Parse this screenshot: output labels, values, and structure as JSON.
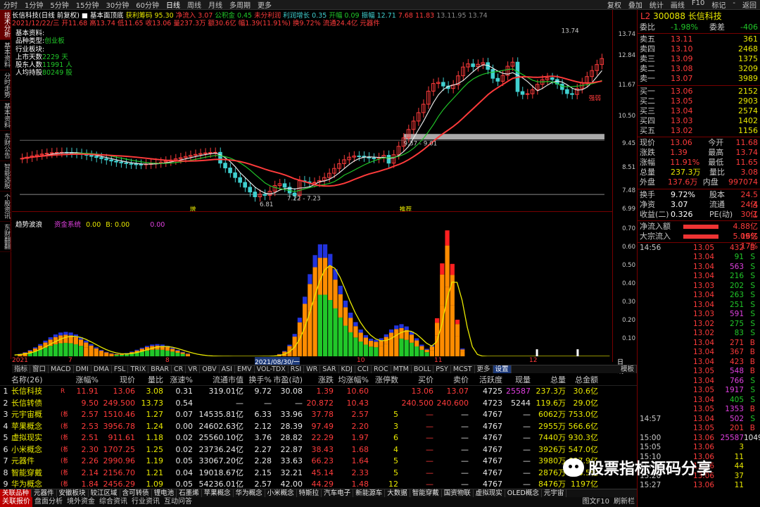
{
  "topbar": {
    "periods": [
      "分时",
      "1分钟",
      "5分钟",
      "15分钟",
      "30分钟",
      "60分钟",
      "日线",
      "周线",
      "月线",
      "多周期",
      "更多"
    ],
    "active": "日线",
    "right": [
      "复权",
      "叠加",
      "统计",
      "画线",
      "F10",
      "标记",
      "-",
      "返回"
    ]
  },
  "leftnav": [
    "技术分析",
    "基本资料",
    "分时走势",
    "基本资料",
    "东财公告",
    "智能选股",
    "个股资讯",
    "东财翻翻"
  ],
  "info": {
    "name": "长信科技(日线 前复权)",
    "indicator": "基本面顶底",
    "items": [
      [
        "获利筹码",
        "95.30",
        "yel"
      ],
      [
        "净流入",
        "3.07",
        "red"
      ],
      [
        "公积金",
        "0.45",
        "grn"
      ],
      [
        "未分利润",
        "",
        "red"
      ],
      [
        "利润增长",
        "0.35",
        "cy"
      ],
      [
        "开幅",
        "0.09",
        "grn"
      ],
      [
        "振幅",
        "12.71",
        "cy"
      ],
      [
        "7.68",
        "11.83",
        "red"
      ],
      [
        "13.11.95",
        "13.74",
        "gry"
      ]
    ],
    "ohlc": "2021/12/22/三  开11.68 高13.74 低11.65 收13.06 量237.3万 额30.6亿 幅1.39(11.91%) 换9.72% 流通24.4亿 元器件"
  },
  "basic": {
    "title": "基本资料:",
    "type_label": "品种类型:",
    "type": "创业板",
    "industry": "行业板块:",
    "days_label": "上市天数",
    "days": "2229",
    "days_unit": "天",
    "holders_label": "股东人数",
    "holders": "11991",
    "holders_unit": "人",
    "per_label": "人均持股",
    "per": "80249",
    "per_unit": "股"
  },
  "axis": {
    "main": [
      "13.74",
      "12.84",
      "11.67",
      "10.50",
      "9.45",
      "8.51",
      "7.48",
      "6.99"
    ],
    "ind": [
      "0.70",
      "0.60",
      "0.50",
      "0.40",
      "0.30",
      "0.20",
      "0.10"
    ]
  },
  "chart_labels": {
    "high": "13.74",
    "low1": "6.81",
    "low2": "7.22 - 7.23",
    "mid": "9.37 - 9.01",
    "label_jz": "强弱",
    "label_zeng": "增",
    "label_tuijian": "推荐",
    "label_s": "S"
  },
  "indicator": {
    "title": "趋势波浪",
    "sys": "资金系统",
    "v1": "0.00",
    "v2": "B: 0.00",
    "v3": "0.00"
  },
  "datebar": {
    "y": "2021",
    "m1": "7",
    "m2": "8",
    "sel": "2021/08/30/一",
    "m3": "10",
    "m4": "11",
    "m5": "12",
    "right": "日线"
  },
  "tabs": [
    "指标",
    "窗口",
    "MACD",
    "DMI",
    "DMA",
    "FSL",
    "TRIX",
    "BRAR",
    "CR",
    "VR",
    "OBV",
    "ASI",
    "EMV",
    "VOL-TDX",
    "RSI",
    "WR",
    "SAR",
    "KDJ",
    "CCI",
    "ROC",
    "MTM",
    "BOLL",
    "PSY",
    "MCST",
    "更多",
    "设置"
  ],
  "tabs_right": "模板",
  "table": {
    "headers": [
      "名称(26)",
      "涨幅%",
      "现价",
      "量比",
      "涨速%",
      "流通市值",
      "换手%",
      "市盈(动)",
      "涨跌",
      "均涨幅%",
      "涨停数",
      "买价",
      "卖价",
      "活跃度",
      "现量",
      "总量",
      "总金额"
    ],
    "rows": [
      [
        "1",
        "长信科技",
        "R",
        "11.91",
        "13.06",
        "3.08",
        "0.31",
        "319.01亿",
        "9.72",
        "30.08",
        "1.39",
        "10.60",
        "",
        "13.06",
        "13.07",
        "4725",
        "25587",
        "237.3万",
        "30.6亿"
      ],
      [
        "2",
        "长信转债",
        "",
        "9.50",
        "249.500",
        "13.73",
        "0.54",
        "—",
        "—",
        "—",
        "20.872",
        "10.43",
        "",
        "240.500",
        "240.600",
        "4723",
        "5244",
        "119.6万",
        "29.0亿"
      ],
      [
        "3",
        "元宇宙概",
        "(板指)",
        "2.57",
        "1510.46",
        "1.27",
        "0.07",
        "14535.81亿",
        "6.33",
        "33.96",
        "37.78",
        "2.57",
        "5",
        "—",
        "—",
        "4767",
        "—",
        "6062万",
        "753.0亿"
      ],
      [
        "4",
        "苹果概念",
        "(板指)",
        "2.53",
        "3956.78",
        "1.24",
        "0.00",
        "24602.63亿",
        "2.12",
        "28.39",
        "97.49",
        "2.20",
        "3",
        "—",
        "—",
        "4767",
        "—",
        "2955万",
        "566.6亿"
      ],
      [
        "5",
        "虚拟现实",
        "(板指)",
        "2.51",
        "911.61",
        "1.18",
        "0.02",
        "25560.10亿",
        "3.76",
        "28.82",
        "22.29",
        "1.97",
        "6",
        "—",
        "—",
        "4767",
        "—",
        "7440万",
        "930.3亿"
      ],
      [
        "6",
        "小米概念",
        "(板指)",
        "2.30",
        "1707.25",
        "1.25",
        "0.02",
        "23736.24亿",
        "2.27",
        "22.87",
        "38.43",
        "1.68",
        "4",
        "—",
        "—",
        "4767",
        "—",
        "3926万",
        "547.0亿"
      ],
      [
        "7",
        "元器件",
        "(板指)",
        "2.26",
        "2990.96",
        "1.19",
        "0.05",
        "33067.20亿",
        "2.28",
        "33.63",
        "66.23",
        "1.64",
        "5",
        "—",
        "—",
        "4767",
        "—",
        "3980万",
        "697.9亿"
      ],
      [
        "8",
        "智能穿戴",
        "(板指)",
        "2.14",
        "2156.70",
        "1.21",
        "0.04",
        "19018.67亿",
        "2.15",
        "32.21",
        "45.14",
        "2.33",
        "5",
        "—",
        "—",
        "4767",
        "—",
        "2876万",
        "566.5亿"
      ],
      [
        "9",
        "华为概念",
        "(板指)",
        "1.84",
        "2456.29",
        "1.09",
        "0.05",
        "54236.01亿",
        "2.57",
        "42.00",
        "44.29",
        "1.48",
        "12",
        "—",
        "—",
        "4767",
        "—",
        "8476万",
        "1197亿"
      ]
    ]
  },
  "sectortabs": [
    "关联品种",
    "元器件",
    "安徽板块",
    "较江区域",
    "含可转债",
    "锂电池",
    "石墨烯",
    "苹果概念",
    "华为概念",
    "小米概念",
    "特斯拉",
    "汽车电子",
    "新能源车",
    "大数据",
    "智能穿戴",
    "国资物联",
    "虚拟现实",
    "OLED概念",
    "元宇宙"
  ],
  "bottomtabs": [
    "关联报价",
    "盘面分析",
    "境外资金",
    "综合资讯",
    "行业资讯",
    "互动问答"
  ],
  "bottom_right": "图文F10",
  "bottom_right2": "刷新栏",
  "rp": {
    "code": "300088",
    "name": "长信科技",
    "wb_label": "委比",
    "wb": "-1.98%",
    "wc_label": "委差",
    "wc": "-406",
    "asks": [
      [
        "卖五",
        "13.11",
        "361"
      ],
      [
        "卖四",
        "13.10",
        "2468"
      ],
      [
        "卖三",
        "13.09",
        "1375"
      ],
      [
        "卖二",
        "13.08",
        "3209"
      ],
      [
        "卖一",
        "13.07",
        "3989"
      ]
    ],
    "bids": [
      [
        "买一",
        "13.06",
        "2152"
      ],
      [
        "买二",
        "13.05",
        "2903"
      ],
      [
        "买三",
        "13.04",
        "2574"
      ],
      [
        "买四",
        "13.03",
        "1402"
      ],
      [
        "买五",
        "13.02",
        "1156"
      ]
    ],
    "stats": [
      [
        "现价",
        "13.06",
        "今开",
        "11.68"
      ],
      [
        "涨跌",
        "1.39",
        "最高",
        "13.74"
      ],
      [
        "涨幅",
        "11.91%",
        "最低",
        "11.65"
      ],
      [
        "总量",
        "237.3万",
        "量比",
        "3.08"
      ],
      [
        "外盘",
        "137.6万",
        "内盘",
        "997074"
      ]
    ],
    "stats2": [
      [
        "换手",
        "9.72%",
        "股本",
        "24.5亿"
      ],
      [
        "净资",
        "3.07",
        "流通",
        "24.4亿"
      ],
      [
        "收益(二)",
        "0.326",
        "PE(动)",
        "30.1"
      ]
    ],
    "flow": [
      [
        "净流入额",
        "4.88亿",
        "16%"
      ],
      [
        "大宗流入",
        "5.09亿",
        "17%"
      ]
    ],
    "ticks": [
      [
        "14:56",
        "13.05",
        "432",
        "B"
      ],
      [
        "",
        "13.04",
        "91",
        "S"
      ],
      [
        "",
        "13.04",
        "563",
        "S"
      ],
      [
        "",
        "13.04",
        "216",
        "S"
      ],
      [
        "",
        "13.03",
        "202",
        "S"
      ],
      [
        "",
        "13.04",
        "263",
        "S"
      ],
      [
        "",
        "13.04",
        "251",
        "S"
      ],
      [
        "",
        "13.03",
        "591",
        "S"
      ],
      [
        "",
        "13.02",
        "275",
        "S"
      ],
      [
        "",
        "13.02",
        "83",
        "S"
      ],
      [
        "",
        "13.04",
        "271",
        "B"
      ],
      [
        "",
        "13.04",
        "367",
        "B"
      ],
      [
        "",
        "13.04",
        "423",
        "B"
      ],
      [
        "",
        "13.05",
        "548",
        "B"
      ],
      [
        "",
        "13.04",
        "766",
        "S"
      ],
      [
        "",
        "13.05",
        "1917",
        "S"
      ],
      [
        "",
        "13.04",
        "405",
        "S"
      ],
      [
        "",
        "13.05",
        "1353",
        "B"
      ],
      [
        "14:57",
        "13.04",
        "502",
        "S"
      ],
      [
        "",
        "13.05",
        "201",
        "B"
      ],
      [
        "15:00",
        "13.06",
        "25587",
        "1049"
      ],
      [
        "15:05",
        "13.06",
        "3",
        ""
      ],
      [
        "15:10",
        "13.06",
        "11",
        ""
      ],
      [
        "15:15",
        "13.06",
        "44",
        ""
      ],
      [
        "15:20",
        "13.06",
        "37",
        ""
      ],
      [
        "15:27",
        "13.06",
        "11",
        ""
      ]
    ]
  },
  "watermark": "股票指标源码分享"
}
